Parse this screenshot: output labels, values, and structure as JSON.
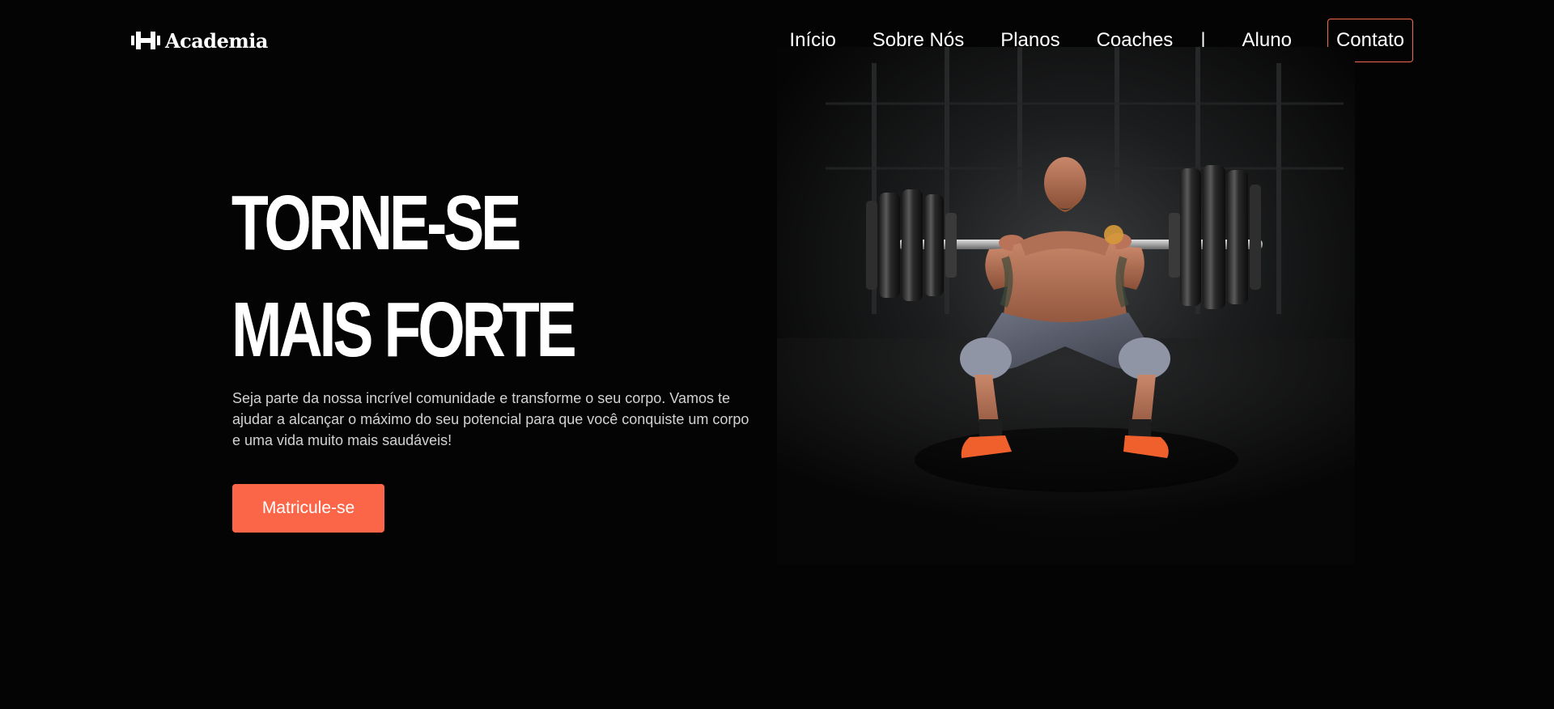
{
  "header": {
    "logo_text": "Academia",
    "logo_icon": "dumbbell-icon",
    "nav": {
      "items": [
        "Início",
        "Sobre Nós",
        "Planos",
        "Coaches"
      ],
      "separator": "|",
      "student_link": "Aluno",
      "contact_button": "Contato"
    }
  },
  "hero": {
    "title_line1": "TORNE-SE",
    "title_line2": "MAIS FORTE",
    "description": "Seja parte da nossa incrível comunidade e transforme o seu corpo. Vamos te ajudar a alcançar o máximo do seu potencial para que você conquiste um corpo e uma vida muito mais saudáveis!",
    "cta_label": "Matricule-se",
    "image": "weightlifter-squat-photo"
  },
  "colors": {
    "background": "#040404",
    "accent": "#fb6649",
    "text": "#ffffff",
    "muted_text": "#d2d2d2"
  }
}
